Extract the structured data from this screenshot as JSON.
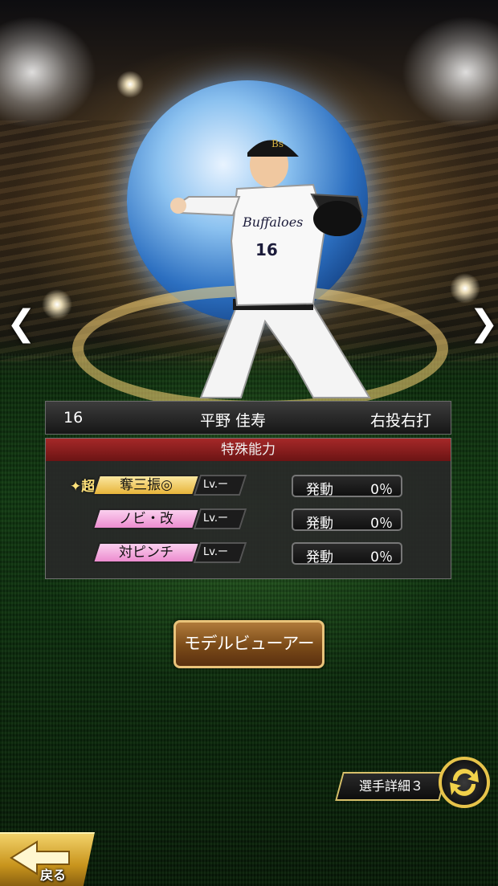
{
  "player": {
    "number": "16",
    "name": "平野 佳寿",
    "throw_bat": "右投右打",
    "uniform_text": "Buffaloes",
    "uniform_number": "16",
    "cap_logo": "Bs"
  },
  "abilities": {
    "header": "特殊能力",
    "super_badge": "超",
    "items": [
      {
        "name": "奪三振◎",
        "level": "Lv.ー",
        "activation_label": "発動",
        "activation_value": "0％",
        "tier": "gold"
      },
      {
        "name": "ノビ・改",
        "level": "Lv.ー",
        "activation_label": "発動",
        "activation_value": "0％",
        "tier": "pink"
      },
      {
        "name": "対ピンチ",
        "level": "Lv.ー",
        "activation_label": "発動",
        "activation_value": "0％",
        "tier": "pink"
      }
    ]
  },
  "buttons": {
    "model_viewer": "モデルビューアー",
    "player_detail": "選手詳細３",
    "back": "戻る"
  },
  "nav": {
    "prev_arrow": "❮",
    "next_arrow": "❯"
  },
  "icons": [
    "chevron-left-icon",
    "chevron-right-icon",
    "swap-cycle-icon",
    "back-arrow-icon"
  ],
  "colors": {
    "header_red": "#a52828",
    "gold_tier": "#f2c94a",
    "pink_tier": "#f2a0d8",
    "button_brown": "#7a4a18",
    "accent_gold": "#e6c34a"
  }
}
